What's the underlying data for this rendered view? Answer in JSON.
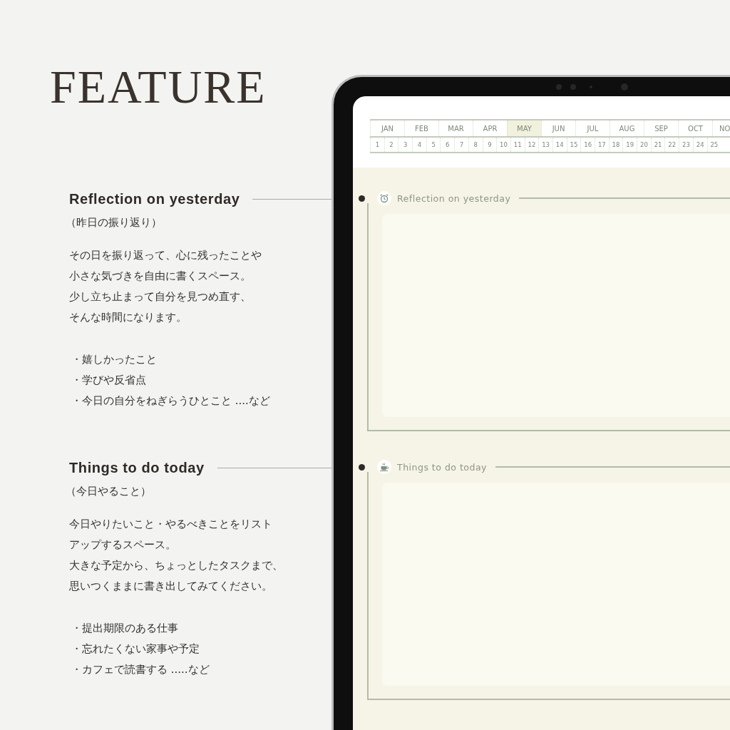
{
  "title": "FEATURE",
  "features": [
    {
      "heading": "Reflection on yesterday",
      "subheading": "（昨日の振り返り）",
      "paragraph": [
        "その日を振り返って、心に残ったことや",
        "小さな気づきを自由に書くスペース。",
        "少し立ち止まって自分を見つめ直す、",
        "そんな時間になります。"
      ],
      "bullets": [
        "・嬉しかったこと",
        "・学びや反省点",
        "・今日の自分をねぎらうひとこと ....など"
      ]
    },
    {
      "heading": "Things to do today",
      "subheading": "（今日やること）",
      "paragraph": [
        "今日やりたいこと・やるべきことをリスト",
        "アップするスペース。",
        "大きな予定から、ちょっとしたタスクまで、",
        "思いつくままに書き出してみてください。"
      ],
      "bullets": [
        "・提出期限のある仕事",
        "・忘れたくない家事や予定",
        "・カフェで読書する .....など"
      ]
    }
  ],
  "tablet": {
    "months": [
      {
        "label": "JAN",
        "selected": false
      },
      {
        "label": "FEB",
        "selected": false
      },
      {
        "label": "MAR",
        "selected": false
      },
      {
        "label": "APR",
        "selected": false
      },
      {
        "label": "MAY",
        "selected": true
      },
      {
        "label": "JUN",
        "selected": false
      },
      {
        "label": "JUL",
        "selected": false
      },
      {
        "label": "AUG",
        "selected": false
      },
      {
        "label": "SEP",
        "selected": false
      },
      {
        "label": "OCT",
        "selected": false
      },
      {
        "label": "NO",
        "selected": false
      }
    ],
    "days": [
      "1",
      "2",
      "3",
      "4",
      "5",
      "6",
      "7",
      "8",
      "9",
      "10",
      "11",
      "12",
      "13",
      "14",
      "15",
      "16",
      "17",
      "18",
      "19",
      "20",
      "21",
      "22",
      "23",
      "24",
      "25"
    ],
    "panels": [
      {
        "title": "Reflection on yesterday",
        "kind": "alarm"
      },
      {
        "title": "Things to do today",
        "kind": "cup"
      }
    ]
  }
}
